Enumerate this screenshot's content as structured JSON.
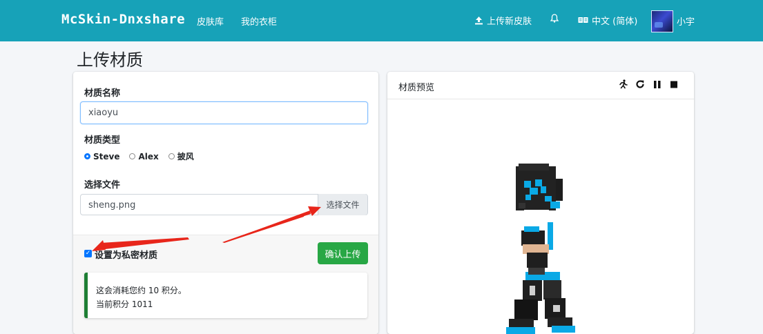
{
  "navbar": {
    "brand": "McSkin-Dnxshare",
    "links": [
      "皮肤库",
      "我的衣柜"
    ],
    "upload_label": "上传新皮肤",
    "language_label": "中文 (简体)",
    "user_name": "小宇",
    "color": "#17a2b8"
  },
  "page": {
    "title": "上传材质"
  },
  "form": {
    "name_label": "材质名称",
    "name_value": "xiaoyu",
    "type_label": "材质类型",
    "types": [
      "Steve",
      "Alex",
      "披风"
    ],
    "selected_type": "Steve",
    "file_label": "选择文件",
    "file_value": "sheng.png",
    "file_button": "选择文件",
    "private_label": "设置为私密材质",
    "private_checked": true,
    "submit_label": "确认上传",
    "callout_line1": "这会消耗您约 10 积分。",
    "callout_line2": "当前积分 1011"
  },
  "preview": {
    "title": "材质预览",
    "tool_icons": [
      "run-icon",
      "rotate-icon",
      "pause-icon",
      "stop-icon"
    ]
  },
  "colors": {
    "accent": "#17a2b8",
    "submit": "#28a745",
    "arrow": "#e8261b",
    "skin_blue": "#0aa9e6"
  }
}
